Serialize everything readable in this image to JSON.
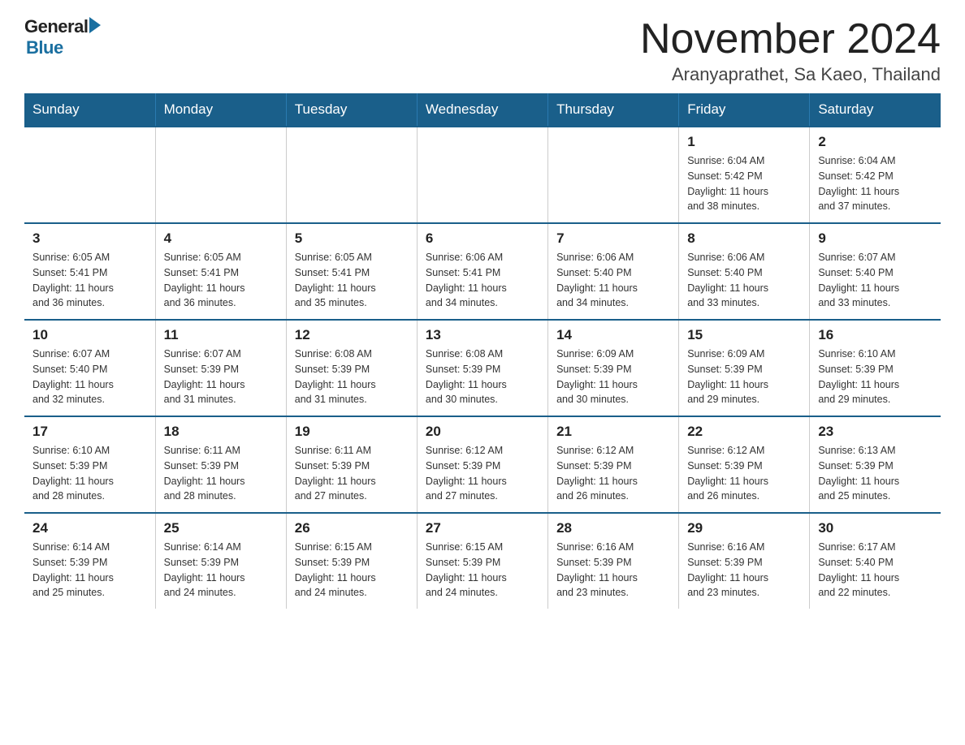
{
  "header": {
    "logo_general": "General",
    "logo_blue": "Blue",
    "month_title": "November 2024",
    "location": "Aranyaprathet, Sa Kaeo, Thailand"
  },
  "weekdays": [
    "Sunday",
    "Monday",
    "Tuesday",
    "Wednesday",
    "Thursday",
    "Friday",
    "Saturday"
  ],
  "weeks": [
    [
      {
        "day": "",
        "info": ""
      },
      {
        "day": "",
        "info": ""
      },
      {
        "day": "",
        "info": ""
      },
      {
        "day": "",
        "info": ""
      },
      {
        "day": "",
        "info": ""
      },
      {
        "day": "1",
        "info": "Sunrise: 6:04 AM\nSunset: 5:42 PM\nDaylight: 11 hours\nand 38 minutes."
      },
      {
        "day": "2",
        "info": "Sunrise: 6:04 AM\nSunset: 5:42 PM\nDaylight: 11 hours\nand 37 minutes."
      }
    ],
    [
      {
        "day": "3",
        "info": "Sunrise: 6:05 AM\nSunset: 5:41 PM\nDaylight: 11 hours\nand 36 minutes."
      },
      {
        "day": "4",
        "info": "Sunrise: 6:05 AM\nSunset: 5:41 PM\nDaylight: 11 hours\nand 36 minutes."
      },
      {
        "day": "5",
        "info": "Sunrise: 6:05 AM\nSunset: 5:41 PM\nDaylight: 11 hours\nand 35 minutes."
      },
      {
        "day": "6",
        "info": "Sunrise: 6:06 AM\nSunset: 5:41 PM\nDaylight: 11 hours\nand 34 minutes."
      },
      {
        "day": "7",
        "info": "Sunrise: 6:06 AM\nSunset: 5:40 PM\nDaylight: 11 hours\nand 34 minutes."
      },
      {
        "day": "8",
        "info": "Sunrise: 6:06 AM\nSunset: 5:40 PM\nDaylight: 11 hours\nand 33 minutes."
      },
      {
        "day": "9",
        "info": "Sunrise: 6:07 AM\nSunset: 5:40 PM\nDaylight: 11 hours\nand 33 minutes."
      }
    ],
    [
      {
        "day": "10",
        "info": "Sunrise: 6:07 AM\nSunset: 5:40 PM\nDaylight: 11 hours\nand 32 minutes."
      },
      {
        "day": "11",
        "info": "Sunrise: 6:07 AM\nSunset: 5:39 PM\nDaylight: 11 hours\nand 31 minutes."
      },
      {
        "day": "12",
        "info": "Sunrise: 6:08 AM\nSunset: 5:39 PM\nDaylight: 11 hours\nand 31 minutes."
      },
      {
        "day": "13",
        "info": "Sunrise: 6:08 AM\nSunset: 5:39 PM\nDaylight: 11 hours\nand 30 minutes."
      },
      {
        "day": "14",
        "info": "Sunrise: 6:09 AM\nSunset: 5:39 PM\nDaylight: 11 hours\nand 30 minutes."
      },
      {
        "day": "15",
        "info": "Sunrise: 6:09 AM\nSunset: 5:39 PM\nDaylight: 11 hours\nand 29 minutes."
      },
      {
        "day": "16",
        "info": "Sunrise: 6:10 AM\nSunset: 5:39 PM\nDaylight: 11 hours\nand 29 minutes."
      }
    ],
    [
      {
        "day": "17",
        "info": "Sunrise: 6:10 AM\nSunset: 5:39 PM\nDaylight: 11 hours\nand 28 minutes."
      },
      {
        "day": "18",
        "info": "Sunrise: 6:11 AM\nSunset: 5:39 PM\nDaylight: 11 hours\nand 28 minutes."
      },
      {
        "day": "19",
        "info": "Sunrise: 6:11 AM\nSunset: 5:39 PM\nDaylight: 11 hours\nand 27 minutes."
      },
      {
        "day": "20",
        "info": "Sunrise: 6:12 AM\nSunset: 5:39 PM\nDaylight: 11 hours\nand 27 minutes."
      },
      {
        "day": "21",
        "info": "Sunrise: 6:12 AM\nSunset: 5:39 PM\nDaylight: 11 hours\nand 26 minutes."
      },
      {
        "day": "22",
        "info": "Sunrise: 6:12 AM\nSunset: 5:39 PM\nDaylight: 11 hours\nand 26 minutes."
      },
      {
        "day": "23",
        "info": "Sunrise: 6:13 AM\nSunset: 5:39 PM\nDaylight: 11 hours\nand 25 minutes."
      }
    ],
    [
      {
        "day": "24",
        "info": "Sunrise: 6:14 AM\nSunset: 5:39 PM\nDaylight: 11 hours\nand 25 minutes."
      },
      {
        "day": "25",
        "info": "Sunrise: 6:14 AM\nSunset: 5:39 PM\nDaylight: 11 hours\nand 24 minutes."
      },
      {
        "day": "26",
        "info": "Sunrise: 6:15 AM\nSunset: 5:39 PM\nDaylight: 11 hours\nand 24 minutes."
      },
      {
        "day": "27",
        "info": "Sunrise: 6:15 AM\nSunset: 5:39 PM\nDaylight: 11 hours\nand 24 minutes."
      },
      {
        "day": "28",
        "info": "Sunrise: 6:16 AM\nSunset: 5:39 PM\nDaylight: 11 hours\nand 23 minutes."
      },
      {
        "day": "29",
        "info": "Sunrise: 6:16 AM\nSunset: 5:39 PM\nDaylight: 11 hours\nand 23 minutes."
      },
      {
        "day": "30",
        "info": "Sunrise: 6:17 AM\nSunset: 5:40 PM\nDaylight: 11 hours\nand 22 minutes."
      }
    ]
  ]
}
